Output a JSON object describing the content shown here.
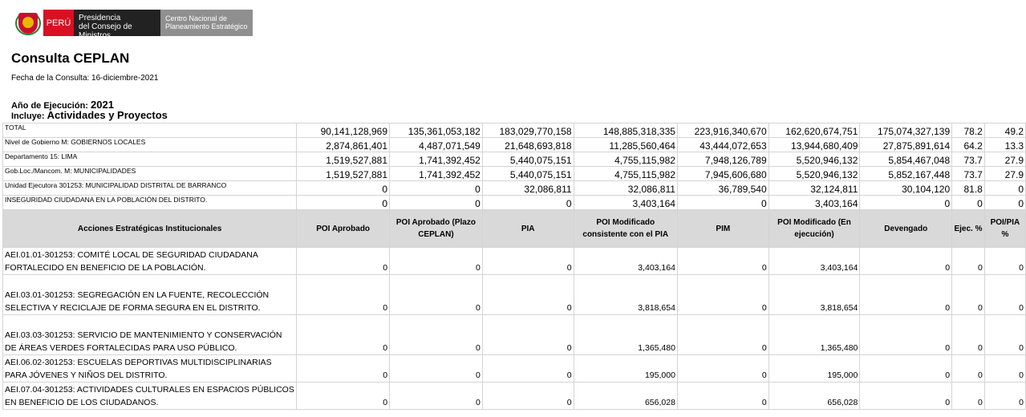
{
  "header": {
    "peru": "PERÚ",
    "pcm_line1": "Presidencia",
    "pcm_line2": "del Consejo de Ministros",
    "ceplan_line1": "Centro Nacional de",
    "ceplan_line2": "Planeamiento Estratégico"
  },
  "title": "Consulta CEPLAN",
  "fecha": "Fecha de la Consulta: 16-diciembre-2021",
  "anio_label": "Año de Ejecución: ",
  "anio_value": "2021",
  "incluye_label": "Incluye: ",
  "incluye_value": "Actividades y Proyectos",
  "summary": [
    {
      "label": "TOTAL",
      "v": [
        "90,141,128,969",
        "135,361,053,182",
        "183,029,770,158",
        "148,885,318,335",
        "223,916,340,670",
        "162,620,674,751",
        "175,074,327,139",
        "78.2",
        "49.2"
      ]
    },
    {
      "label": "Nivel de Gobierno M: GOBIERNOS LOCALES",
      "v": [
        "2,874,861,401",
        "4,487,071,549",
        "21,648,693,818",
        "11,285,560,464",
        "43,444,072,653",
        "13,944,680,409",
        "27,875,891,614",
        "64.2",
        "13.3"
      ]
    },
    {
      "label": "Departamento 15: LIMA",
      "v": [
        "1,519,527,881",
        "1,741,392,452",
        "5,440,075,151",
        "4,755,115,982",
        "7,948,126,789",
        "5,520,946,132",
        "5,854,467,048",
        "73.7",
        "27.9"
      ]
    },
    {
      "label": "Gob.Loc./Mancom. M: MUNICIPALIDADES",
      "v": [
        "1,519,527,881",
        "1,741,392,452",
        "5,440,075,151",
        "4,755,115,982",
        "7,945,606,680",
        "5,520,946,132",
        "5,852,167,448",
        "73.7",
        "27.9"
      ]
    },
    {
      "label": "Unidad Ejecutora 301253: MUNICIPALIDAD DISTRITAL DE BARRANCO",
      "v": [
        "0",
        "0",
        "32,086,811",
        "32,086,811",
        "36,789,540",
        "32,124,811",
        "30,104,120",
        "81.8",
        "0"
      ]
    },
    {
      "label": "INSEGURIDAD CIUDADANA EN LA POBLACIÓN DEL DISTRITO.",
      "v": [
        "0",
        "0",
        "0",
        "3,403,164",
        "0",
        "3,403,164",
        "0",
        "0",
        "0"
      ]
    }
  ],
  "columns": [
    "Acciones Estratégicas Institucionales",
    "POI Aprobado",
    "POI Aprobado (Plazo CEPLAN)",
    "PIA",
    "POI Modificado consistente con el PIA",
    "PIM",
    "POI Modificado (En ejecución)",
    "Devengado",
    "Ejec. %",
    "POI/PIA %"
  ],
  "rows": [
    {
      "label": "AEI.01.01-301253: COMITÉ LOCAL DE SEGURIDAD CIUDADANA FORTALECIDO EN BENEFICIO DE LA POBLACIÓN.",
      "v": [
        "0",
        "0",
        "0",
        "3,403,164",
        "0",
        "3,403,164",
        "0",
        "0",
        "0"
      ]
    },
    {
      "label": "AEI.03.01-301253: SEGREGACIÓN EN LA FUENTE, RECOLECCIÓN SELECTIVA Y RECICLAJE DE FORMA SEGURA EN EL DISTRITO.",
      "v": [
        "0",
        "0",
        "0",
        "3,818,654",
        "0",
        "3,818,654",
        "0",
        "0",
        "0"
      ]
    },
    {
      "label": "AEI.03.03-301253: SERVICIO DE MANTENIMIENTO Y CONSERVACIÓN DE ÁREAS VERDES FORTALECIDAS PARA USO PÚBLICO.",
      "v": [
        "0",
        "0",
        "0",
        "1,365,480",
        "0",
        "1,365,480",
        "0",
        "0",
        "0"
      ]
    },
    {
      "label": "AEI.06.02-301253: ESCUELAS DEPORTIVAS MULTIDISCIPLINARIAS PARA JÓVENES Y NIÑOS DEL DISTRITO.",
      "v": [
        "0",
        "0",
        "0",
        "195,000",
        "0",
        "195,000",
        "0",
        "0",
        "0"
      ]
    },
    {
      "label": "AEI.07.04-301253: ACTIVIDADES CULTURALES EN ESPACIOS PÚBLICOS EN BENEFICIO DE LOS CIUDADANOS.",
      "v": [
        "0",
        "0",
        "0",
        "656,028",
        "0",
        "656,028",
        "0",
        "0",
        "0"
      ]
    }
  ]
}
